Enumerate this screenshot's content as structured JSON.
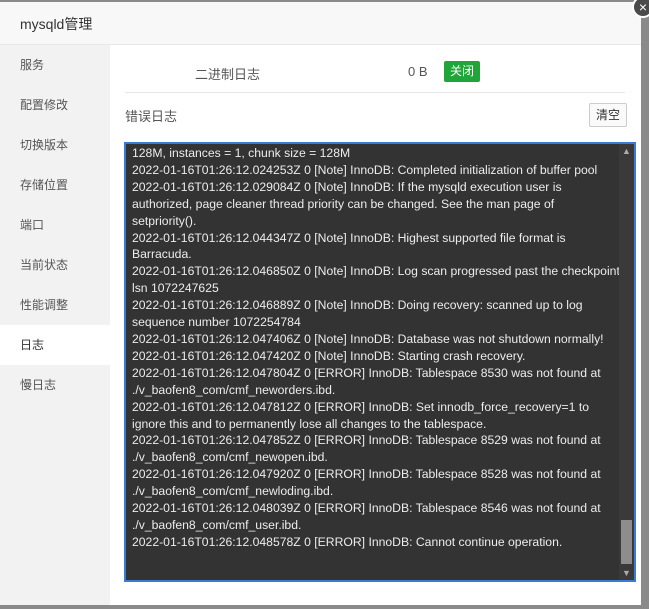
{
  "window": {
    "title": "mysqld管理",
    "close_glyph": "×"
  },
  "sidebar": {
    "items": [
      {
        "label": "服务"
      },
      {
        "label": "配置修改"
      },
      {
        "label": "切换版本"
      },
      {
        "label": "存储位置"
      },
      {
        "label": "端口"
      },
      {
        "label": "当前状态"
      },
      {
        "label": "性能调整"
      },
      {
        "label": "日志",
        "active": true
      },
      {
        "label": "慢日志"
      }
    ]
  },
  "binlog": {
    "label": "二进制日志",
    "size": "0 B",
    "toggle_label": "关闭"
  },
  "error_log": {
    "label": "错误日志",
    "clear_label": "清空",
    "lines": [
      "128M, instances = 1, chunk size = 128M",
      "2022-01-16T01:26:12.024253Z 0 [Note] InnoDB: Completed initialization of buffer pool",
      "2022-01-16T01:26:12.029084Z 0 [Note] InnoDB: If the mysqld execution user is authorized, page cleaner thread priority can be changed. See the man page of setpriority().",
      "2022-01-16T01:26:12.044347Z 0 [Note] InnoDB: Highest supported file format is Barracuda.",
      "2022-01-16T01:26:12.046850Z 0 [Note] InnoDB: Log scan progressed past the checkpoint lsn 1072247625",
      "2022-01-16T01:26:12.046889Z 0 [Note] InnoDB: Doing recovery: scanned up to log sequence number 1072254784",
      "2022-01-16T01:26:12.047406Z 0 [Note] InnoDB: Database was not shutdown normally!",
      "2022-01-16T01:26:12.047420Z 0 [Note] InnoDB: Starting crash recovery.",
      "2022-01-16T01:26:12.047804Z 0 [ERROR] InnoDB: Tablespace 8530 was not found at ./v_baofen8_com/cmf_neworders.ibd.",
      "2022-01-16T01:26:12.047812Z 0 [ERROR] InnoDB: Set innodb_force_recovery=1 to ignore this and to permanently lose all changes to the tablespace.",
      "2022-01-16T01:26:12.047852Z 0 [ERROR] InnoDB: Tablespace 8529 was not found at ./v_baofen8_com/cmf_newopen.ibd.",
      "2022-01-16T01:26:12.047920Z 0 [ERROR] InnoDB: Tablespace 8528 was not found at ./v_baofen8_com/cmf_newloding.ibd.",
      "2022-01-16T01:26:12.048039Z 0 [ERROR] InnoDB: Tablespace 8546 was not found at ./v_baofen8_com/cmf_user.ibd.",
      "2022-01-16T01:26:12.048578Z 0 [ERROR] InnoDB: Cannot continue operation."
    ]
  },
  "colors": {
    "accent_green": "#20a53a",
    "focus_blue": "#3a7bd5",
    "log_bg": "#333333"
  },
  "icons": {
    "scroll_up": "chevron-up-icon",
    "scroll_down": "chevron-down-icon",
    "close": "close-icon"
  }
}
